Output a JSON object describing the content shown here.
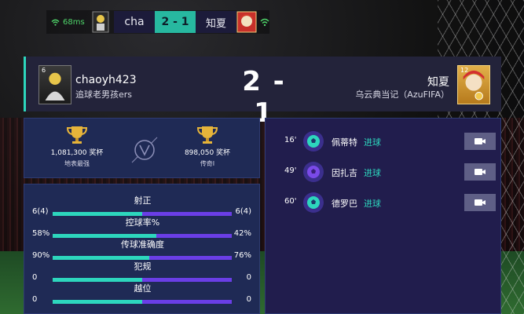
{
  "hud": {
    "ping": "68ms",
    "home_short": "cha",
    "score": "2 - 1",
    "away_short": "知夏"
  },
  "header": {
    "home_name": "chaoyh423",
    "home_club": "追球老男孩ers",
    "home_level": "6",
    "score": "2 - 1",
    "away_name": "知夏",
    "away_club": "乌云典当记（AzuFIFA）",
    "away_level": "12"
  },
  "trophies": {
    "home": {
      "count": "1,081,300 奖杯",
      "rank": "地表最强"
    },
    "away": {
      "count": "898,050 奖杯",
      "rank": "传奇I"
    }
  },
  "stats": [
    {
      "label": "射正",
      "home": "6(4)",
      "away": "6(4)",
      "home_share": 0.5
    },
    {
      "label": "控球率%",
      "home": "58%",
      "away": "42%",
      "home_share": 0.58
    },
    {
      "label": "传球准确度",
      "home": "90%",
      "away": "76%",
      "home_share": 0.54
    },
    {
      "label": "犯规",
      "home": "0",
      "away": "0",
      "home_share": 0.5
    },
    {
      "label": "越位",
      "home": "0",
      "away": "0",
      "home_share": 0.5
    }
  ],
  "events": [
    {
      "minute": "16'",
      "player": "佩蒂特",
      "type": "进球",
      "team": "home"
    },
    {
      "minute": "49'",
      "player": "因扎吉",
      "type": "进球",
      "team": "away"
    },
    {
      "minute": "60'",
      "player": "德罗巴",
      "type": "进球",
      "team": "home"
    }
  ],
  "colors": {
    "home": "#2dd6bd",
    "away": "#6a3ee6"
  }
}
